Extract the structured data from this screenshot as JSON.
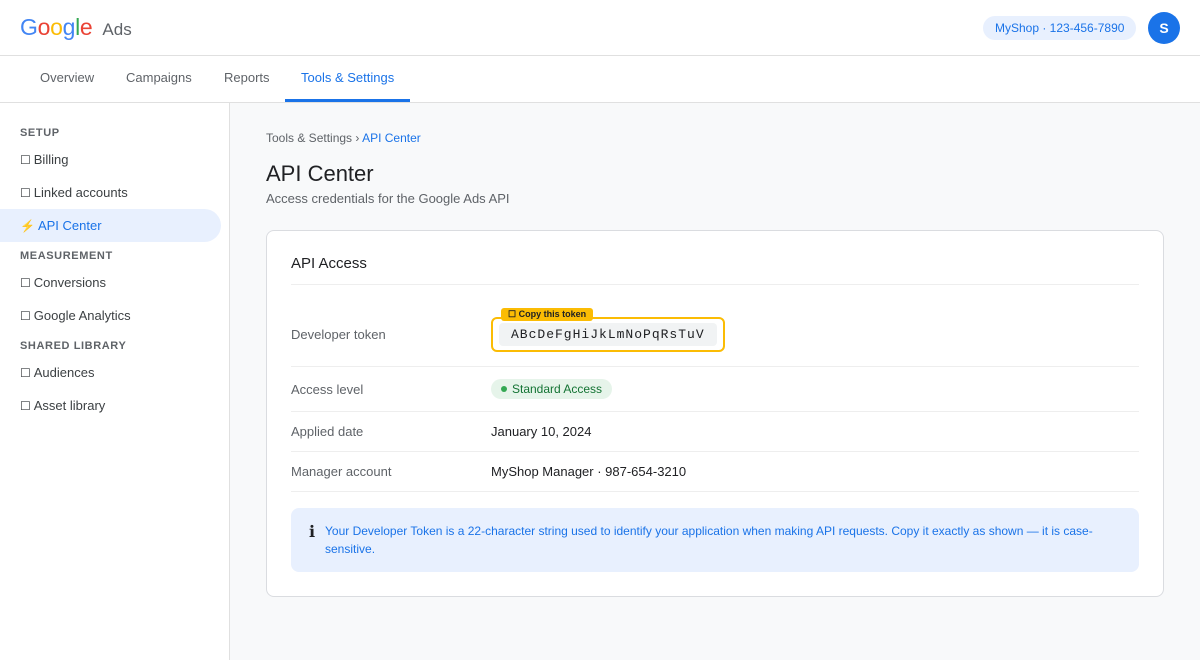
{
  "header": {
    "logo_letters": [
      {
        "char": "G",
        "color": "#4285F4"
      },
      {
        "char": "o",
        "color": "#EA4335"
      },
      {
        "char": "o",
        "color": "#FBBC05"
      },
      {
        "char": "g",
        "color": "#4285F4"
      },
      {
        "char": "l",
        "color": "#34A853"
      },
      {
        "char": "e",
        "color": "#EA4335"
      }
    ],
    "product": "Ads",
    "account_chip": "MyShop · 123-456-7890",
    "avatar_initial": "S"
  },
  "tabs": [
    {
      "label": "Overview",
      "active": false
    },
    {
      "label": "Campaigns",
      "active": false
    },
    {
      "label": "Reports",
      "active": false
    },
    {
      "label": "Tools & Settings",
      "active": true
    }
  ],
  "sidebar": {
    "sections": [
      {
        "title": "SETUP",
        "items": [
          {
            "icon": "☐",
            "icon_name": "billing-icon",
            "label": "Billing",
            "active": false
          },
          {
            "icon": "☐",
            "icon_name": "linked-accounts-icon",
            "label": "Linked accounts",
            "active": false
          },
          {
            "icon": "⚡",
            "icon_name": "lightning-icon",
            "label": "API Center",
            "active": true
          }
        ]
      },
      {
        "title": "MEASUREMENT",
        "items": [
          {
            "icon": "☐",
            "icon_name": "conversions-icon",
            "label": "Conversions",
            "active": false
          },
          {
            "icon": "☐",
            "icon_name": "analytics-icon",
            "label": "Google Analytics",
            "active": false
          }
        ]
      },
      {
        "title": "SHARED LIBRARY",
        "items": [
          {
            "icon": "☐",
            "icon_name": "audiences-icon",
            "label": "Audiences",
            "active": false
          },
          {
            "icon": "☐",
            "icon_name": "asset-library-icon",
            "label": "Asset library",
            "active": false
          }
        ]
      }
    ]
  },
  "main": {
    "breadcrumb": {
      "parent": "Tools & Settings",
      "separator": "›",
      "current": "API Center"
    },
    "title": "API Center",
    "subtitle": "Access credentials for the Google Ads API",
    "card": {
      "title": "API Access",
      "developer_token_label": "Developer token",
      "developer_token": "ABcDeFgHiJkLmNoPqRsTuV",
      "copy_tag": "☐ Copy this token",
      "access_level_label": "Access level",
      "access_level": "Standard Access",
      "applied_date_label": "Applied date",
      "applied_date": "January 10, 2024",
      "manager_account_label": "Manager account",
      "manager_account": "MyShop Manager · 987-654-3210",
      "info_icon": "ℹ",
      "info_text": "Your Developer Token is a 22-character string used to identify your application when making API requests. Copy it exactly as shown — it is case-sensitive."
    }
  },
  "colors": {
    "accent": "#1a73e8",
    "highlight": "#fbbc04",
    "success": "#137333"
  }
}
